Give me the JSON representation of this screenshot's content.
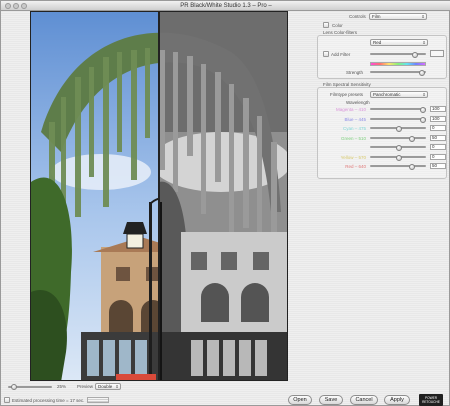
{
  "window": {
    "title": "PR Black/White Studio 1.3 – Pro –"
  },
  "controls": {
    "label": "Controls",
    "selected": "Film"
  },
  "color_checkbox": {
    "label": "Color",
    "checked": false
  },
  "lens_filters": {
    "section": "Lens Color-filters",
    "filter_select": "Red",
    "add_filter": {
      "label": "Add Filter",
      "checked": false
    },
    "filter_level": 0.82,
    "strength_label": "Strength",
    "strength_level": 0.96
  },
  "film_sensitivity": {
    "section": "Film Spectral Sensitivity",
    "presets_label": "Filmtype presets",
    "presets_selected": "Panchromatic",
    "wavelength_label": "Wavelength",
    "bands": [
      {
        "label": "Magenta – 410",
        "value": "100",
        "level": 0.98,
        "color": "#d992d9"
      },
      {
        "label": "Blue – 445",
        "value": "100",
        "level": 0.98,
        "color": "#8a8ae6"
      },
      {
        "label": "Cyan – 475",
        "value": "0",
        "level": 0.5,
        "color": "#7fd6d6"
      },
      {
        "label": "Green – 510",
        "value": "50",
        "level": 0.75,
        "color": "#7fd17f"
      },
      {
        "label": "",
        "value": "0",
        "level": 0.5,
        "color": "#bbbbbb"
      },
      {
        "label": "Yellow – 570",
        "value": "0",
        "level": 0.5,
        "color": "#d6c86a"
      },
      {
        "label": "Red – 640",
        "value": "50",
        "level": 0.75,
        "color": "#e07a7a"
      }
    ]
  },
  "bottom": {
    "zoom": "25%",
    "zoom_level": 0.05,
    "preview_label": "Preview",
    "preview_selected": "Double",
    "estimated": "Estimated processing time = 17 sec.",
    "buttons": {
      "open": "Open",
      "save": "Save",
      "cancel": "Cancel",
      "apply": "Apply"
    },
    "logo_line1": "POWER",
    "logo_line2": "RETOUCHE"
  },
  "colors": {
    "sky_top": "#6f9bd6",
    "sky_bottom": "#c9dcf2",
    "foliage": "#3f5a2e",
    "building": "#c9a781"
  }
}
